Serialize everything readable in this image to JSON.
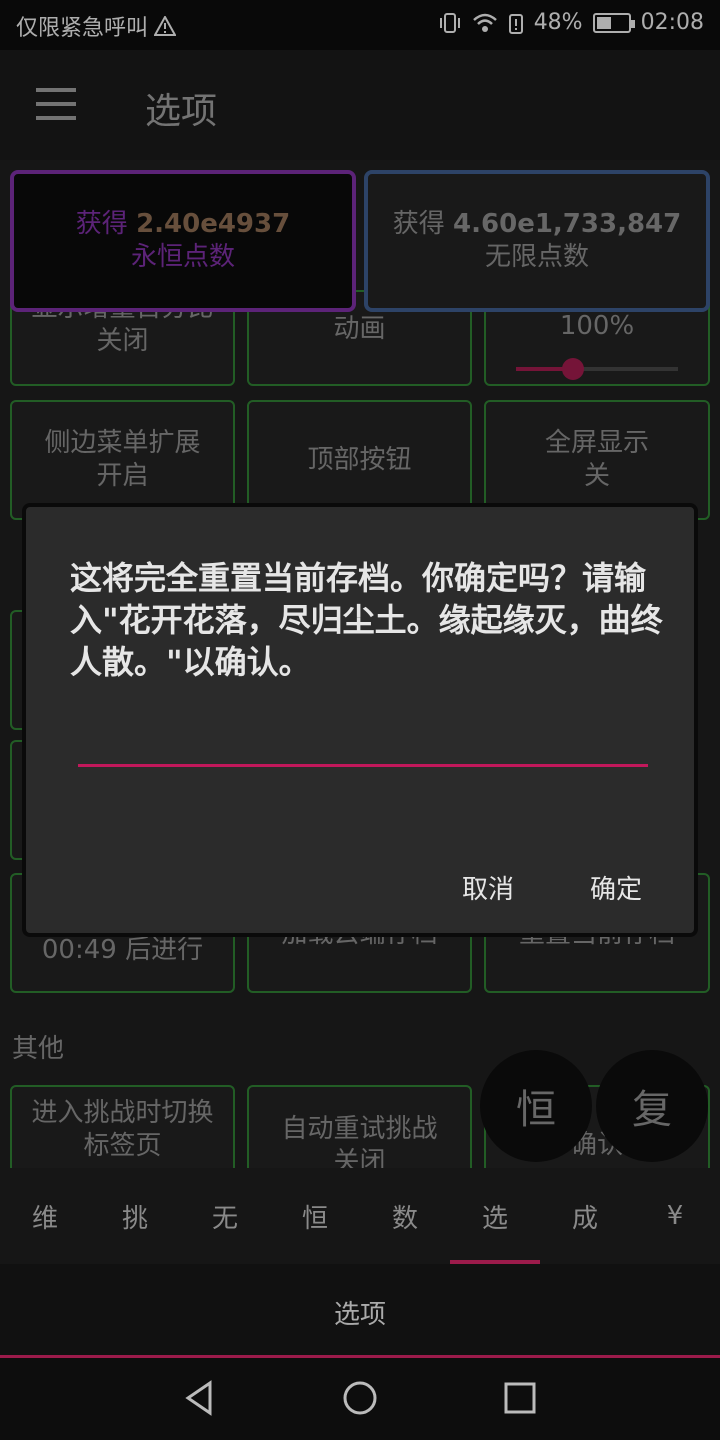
{
  "status_bar": {
    "carrier": "仅限紧急呼叫",
    "battery": "48%",
    "time": "02:08"
  },
  "app_bar": {
    "title": "选项"
  },
  "points": {
    "eternal_prefix": "获得",
    "eternal_value": "2.40e4937",
    "eternal_label": "永恒点数",
    "infinite_prefix": "获得",
    "infinite_value": "4.60e1,733,847",
    "infinite_label": "无限点数"
  },
  "options": {
    "row1": [
      {
        "title": "显示增量百分比",
        "value": "关闭"
      },
      {
        "title": "动画"
      },
      {
        "title": "100%",
        "slider_percent": 0.35
      }
    ],
    "row2": [
      {
        "title": "侧边菜单扩展",
        "value": "开启"
      },
      {
        "title": "顶部按钮"
      },
      {
        "title": "全屏显示",
        "value": "关"
      }
    ],
    "row_partial_label": "00:49 后进行",
    "row_partial_mid": "加载云端存档",
    "row_partial_right": "重置当前存档",
    "section_other": "其他",
    "row_other": [
      {
        "title": "进入挑战时切换",
        "value": "标签页"
      },
      {
        "title": "自动重试挑战",
        "value": "关闭"
      },
      {
        "title": "确认"
      }
    ]
  },
  "fabs": {
    "left": "恒",
    "right": "复"
  },
  "tabs": [
    "维",
    "挑",
    "无",
    "恒",
    "数",
    "选",
    "成",
    "¥"
  ],
  "active_tab": 5,
  "footer_label": "选项",
  "dialog": {
    "message": "这将完全重置当前存档。你确定吗？请输入\"花开花落，尽归尘土。缘起缘灭，曲终人散。\"以确认。",
    "input_value": "",
    "cancel": "取消",
    "confirm": "确定"
  },
  "colors": {
    "accent": "#9c1b4b",
    "tile_border": "#2e7d32",
    "eternal_border": "#7b2fa0",
    "infinite_border": "#3d5a8a"
  }
}
